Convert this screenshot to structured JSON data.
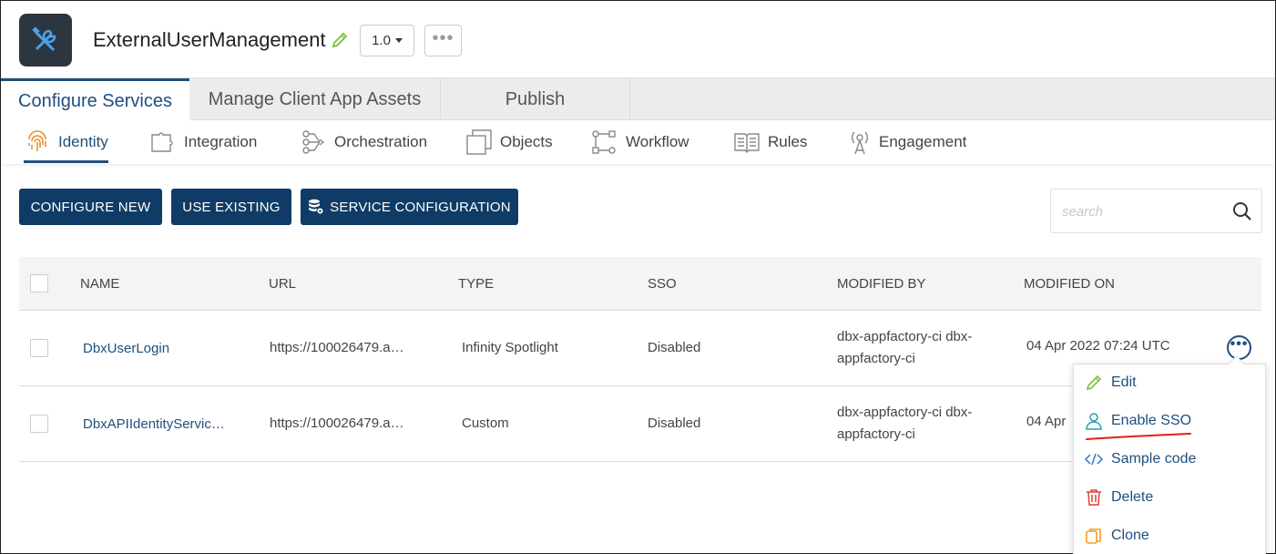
{
  "header": {
    "app_title": "ExternalUserManagement",
    "app_icon": "tools-icon",
    "version": "1.0",
    "more_label": "•••"
  },
  "main_tabs": [
    {
      "label": "Configure Services",
      "active": true
    },
    {
      "label": "Manage Client App Assets",
      "active": false
    },
    {
      "label": "Publish",
      "active": false
    }
  ],
  "sub_tabs": [
    {
      "label": "Identity",
      "icon": "fingerprint-icon",
      "active": true
    },
    {
      "label": "Integration",
      "icon": "puzzle-icon",
      "active": false
    },
    {
      "label": "Orchestration",
      "icon": "flow-icon",
      "active": false
    },
    {
      "label": "Objects",
      "icon": "objects-icon",
      "active": false
    },
    {
      "label": "Workflow",
      "icon": "workflow-icon",
      "active": false
    },
    {
      "label": "Rules",
      "icon": "book-icon",
      "active": false
    },
    {
      "label": "Engagement",
      "icon": "broadcast-icon",
      "active": false
    }
  ],
  "toolbar": {
    "configure_new": "CONFIGURE NEW",
    "use_existing": "USE EXISTING",
    "service_configuration": "SERVICE CONFIGURATION",
    "search_placeholder": "search"
  },
  "table": {
    "columns": [
      "NAME",
      "URL",
      "TYPE",
      "SSO",
      "MODIFIED BY",
      "MODIFIED ON"
    ],
    "rows": [
      {
        "name": "DbxUserLogin",
        "url": "https://100026479.a…",
        "type": "Infinity Spotlight",
        "sso": "Disabled",
        "modified_by_line1": "dbx-appfactory-ci dbx-",
        "modified_by_line2": "appfactory-ci",
        "modified_on": "04 Apr 2022 07:24 UTC"
      },
      {
        "name": "DbxAPIIdentityServic…",
        "url": "https://100026479.a…",
        "type": "Custom",
        "sso": "Disabled",
        "modified_by_line1": "dbx-appfactory-ci dbx-",
        "modified_by_line2": "appfactory-ci",
        "modified_on": "04 Apr"
      }
    ]
  },
  "row_menu": {
    "items": [
      {
        "label": "Edit",
        "icon": "pencil-icon"
      },
      {
        "label": "Enable SSO",
        "icon": "user-icon"
      },
      {
        "label": "Sample code",
        "icon": "code-icon"
      },
      {
        "label": "Delete",
        "icon": "trash-icon"
      },
      {
        "label": "Clone",
        "icon": "copy-icon"
      }
    ]
  },
  "colors": {
    "primary": "#0f3c66",
    "link": "#1e4f7e",
    "annotation": "#e02020"
  }
}
